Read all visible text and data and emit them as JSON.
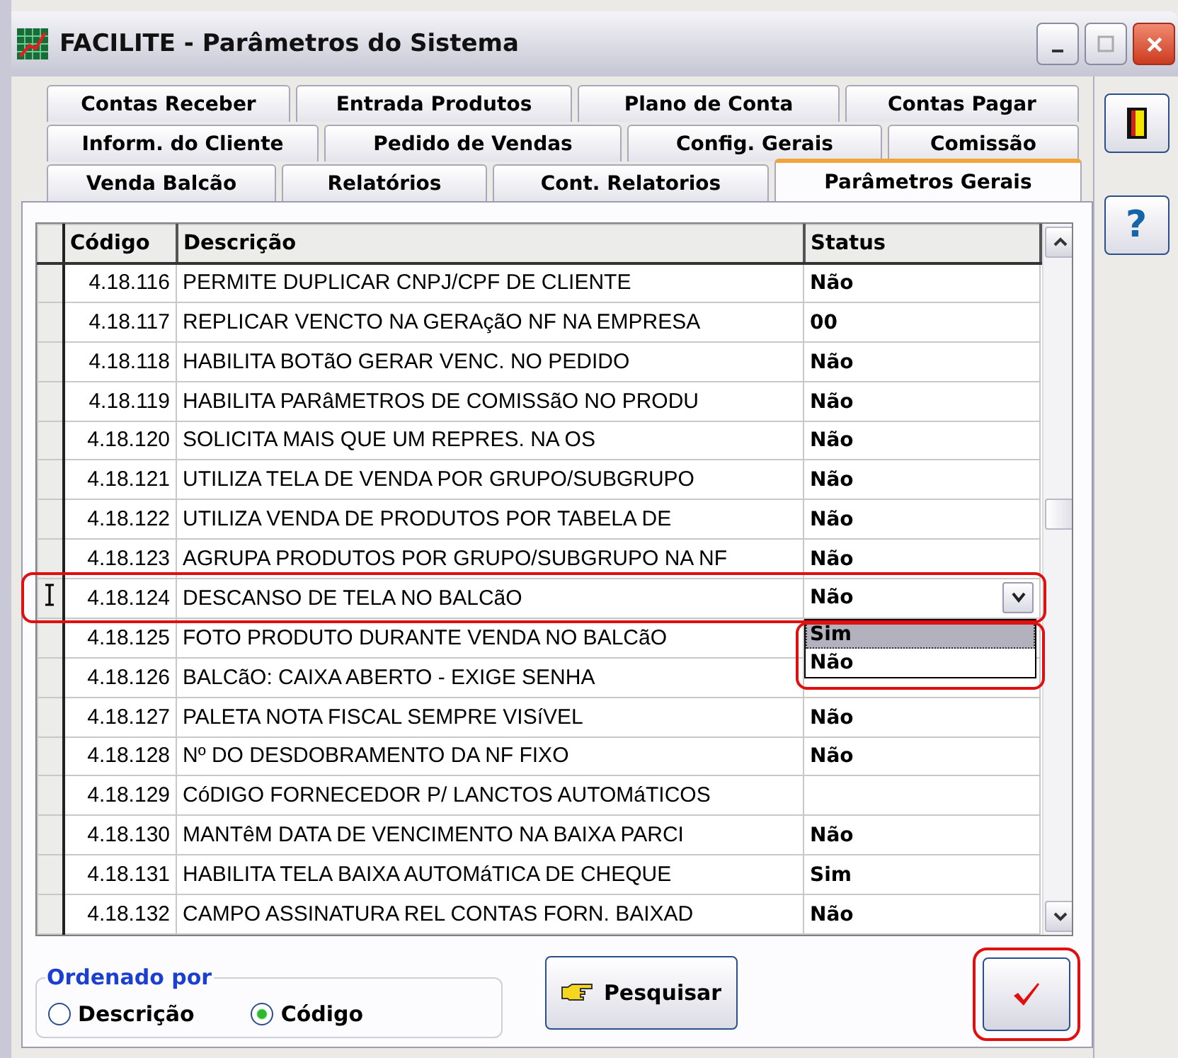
{
  "window": {
    "title": "FACILITE - Parâmetros do Sistema"
  },
  "tab_rows": [
    [
      {
        "label": "Contas Receber",
        "selected": false
      },
      {
        "label": "Entrada Produtos",
        "selected": false
      },
      {
        "label": "Plano de Conta",
        "selected": false
      },
      {
        "label": "Contas Pagar",
        "selected": false
      }
    ],
    [
      {
        "label": "Inform. do Cliente",
        "selected": false
      },
      {
        "label": "Pedido de Vendas",
        "selected": false
      },
      {
        "label": "Config. Gerais",
        "selected": false
      },
      {
        "label": "Comissão",
        "selected": false
      }
    ],
    [
      {
        "label": "Venda Balcão",
        "selected": false
      },
      {
        "label": "Relatórios",
        "selected": false
      },
      {
        "label": "Cont. Relatorios",
        "selected": false
      },
      {
        "label": "Parâmetros Gerais",
        "selected": true
      }
    ]
  ],
  "table": {
    "columns": [
      "Código",
      "Descrição",
      "Status"
    ],
    "rows": [
      {
        "code": "4.18.116",
        "description": "PERMITE DUPLICAR CNPJ/CPF DE CLIENTE",
        "status": "Não",
        "editing": false
      },
      {
        "code": "4.18.117",
        "description": "REPLICAR VENCTO NA GERAçãO NF NA EMPRESA",
        "status": "00",
        "editing": false
      },
      {
        "code": "4.18.118",
        "description": "HABILITA BOTãO GERAR VENC. NO PEDIDO",
        "status": "Não",
        "editing": false
      },
      {
        "code": "4.18.119",
        "description": "HABILITA PARâMETROS DE COMISSãO NO PRODU",
        "status": "Não",
        "editing": false
      },
      {
        "code": "4.18.120",
        "description": "SOLICITA MAIS QUE UM REPRES. NA OS",
        "status": "Não",
        "editing": false
      },
      {
        "code": "4.18.121",
        "description": "UTILIZA TELA DE VENDA POR GRUPO/SUBGRUPO",
        "status": "Não",
        "editing": false
      },
      {
        "code": "4.18.122",
        "description": "UTILIZA VENDA DE PRODUTOS POR TABELA DE",
        "status": "Não",
        "editing": false
      },
      {
        "code": "4.18.123",
        "description": "AGRUPA PRODUTOS POR GRUPO/SUBGRUPO NA NF",
        "status": "Não",
        "editing": false
      },
      {
        "code": "4.18.124",
        "description": "DESCANSO DE TELA NO BALCãO",
        "status": "Não",
        "editing": true
      },
      {
        "code": "4.18.125",
        "description": "FOTO PRODUTO DURANTE VENDA NO BALCãO",
        "editing": false
      },
      {
        "code": "4.18.126",
        "description": "BALCãO: CAIXA ABERTO - EXIGE SENHA",
        "editing": false
      },
      {
        "code": "4.18.127",
        "description": "PALETA NOTA FISCAL SEMPRE VISíVEL",
        "status": "Não",
        "editing": false
      },
      {
        "code": "4.18.128",
        "description": "Nº DO DESDOBRAMENTO DA NF FIXO",
        "status": "Não",
        "editing": false
      },
      {
        "code": "4.18.129",
        "description": "CóDIGO FORNECEDOR P/ LANCTOS AUTOMáTICOS",
        "editing": false
      },
      {
        "code": "4.18.130",
        "description": "MANTêM DATA DE VENCIMENTO NA BAIXA PARCI",
        "status": "Não",
        "editing": false
      },
      {
        "code": "4.18.131",
        "description": "HABILITA TELA BAIXA AUTOMáTICA DE CHEQUE",
        "status": "Sim",
        "editing": false
      },
      {
        "code": "4.18.132",
        "description": "CAMPO ASSINATURA REL CONTAS FORN. BAIXAD",
        "status": "Não",
        "editing": false
      }
    ],
    "dropdown": {
      "options": [
        {
          "label": "Sim",
          "selected": true
        },
        {
          "label": "Não",
          "selected": false
        }
      ]
    }
  },
  "sort_group": {
    "title": "Ordenado por",
    "options": [
      {
        "label": "Descrição",
        "selected": false
      },
      {
        "label": "Código",
        "selected": true
      }
    ]
  },
  "search_button": {
    "label": "Pesquisar"
  },
  "help_button": {
    "label": "?"
  },
  "highlights": {
    "editing_row": true,
    "dropdown": true,
    "confirm_button": true
  }
}
